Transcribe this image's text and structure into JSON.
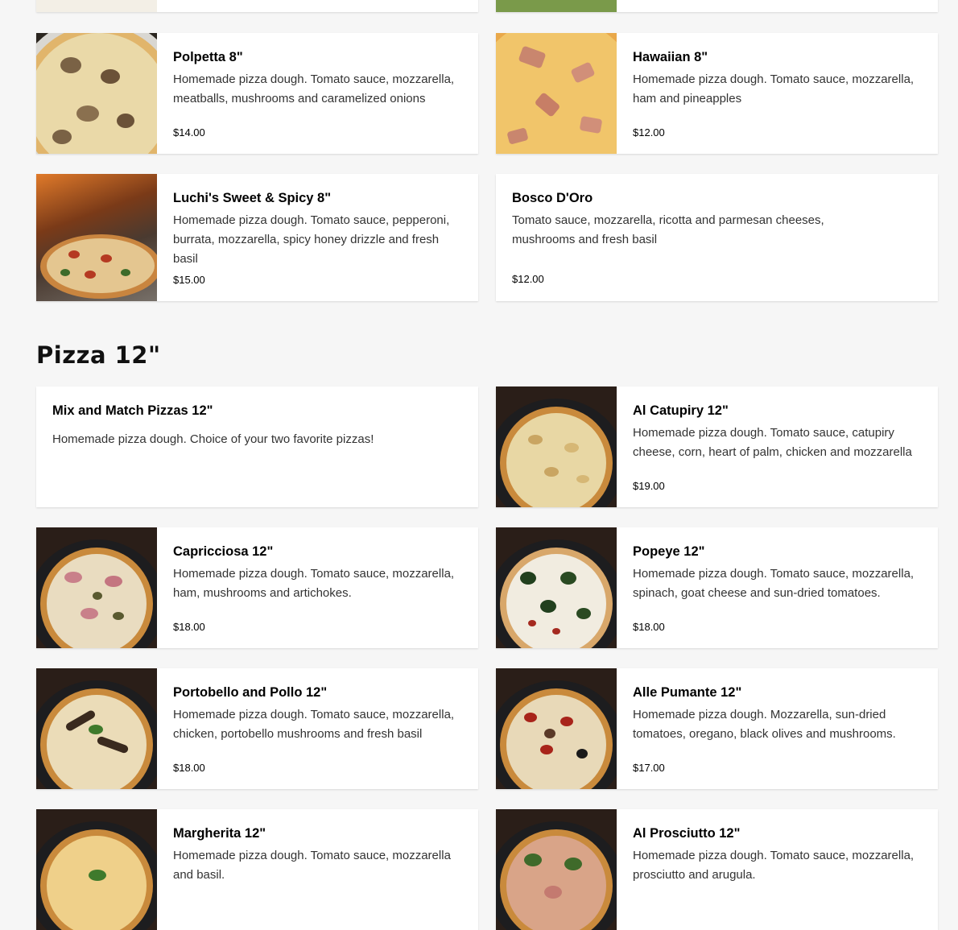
{
  "top_row": [
    {
      "name": "",
      "thumb": "cream"
    },
    {
      "name": "",
      "thumb": "salad"
    }
  ],
  "pizza8": [
    {
      "name": "Polpetta 8\"",
      "desc": "Homemade pizza dough. Tomato sauce, mozzarella, meatballs, mushrooms and caramelized onions",
      "price": "$14.00",
      "thumb": "mushroom"
    },
    {
      "name": "Hawaiian 8\"",
      "desc": "Homemade pizza dough. Tomato sauce, mozzarella, ham and pineapples",
      "price": "$12.00",
      "thumb": "ham"
    },
    {
      "name": "Luchi's Sweet & Spicy 8\"",
      "desc": "Homemade pizza dough. Tomato sauce, pepperoni, burrata, mozzarella, spicy honey drizzle and fresh basil",
      "price": "$15.00",
      "thumb": "oven"
    },
    {
      "name": "Bosco D'Oro",
      "desc": "Tomato sauce, mozzarella, ricotta and parmesan cheeses, mushrooms and fresh basil",
      "price": "$12.00",
      "thumb": ""
    }
  ],
  "section": {
    "title": "Pizza 12\""
  },
  "pizza12": [
    {
      "name": "Mix and Match Pizzas 12\"",
      "desc": "Homemade pizza dough. Choice of your two favorite pizzas!",
      "price": "",
      "thumb": ""
    },
    {
      "name": "Al Catupiry 12\"",
      "desc": "Homemade pizza dough. Tomato sauce, catupiry cheese, corn, heart of palm, chicken and mozzarella",
      "price": "$19.00",
      "thumb": "catupiry"
    },
    {
      "name": "Capricciosa 12\"",
      "desc": "Homemade pizza dough. Tomato sauce, mozzarella, ham, mushrooms and artichokes.",
      "price": "$18.00",
      "thumb": "capricciosa"
    },
    {
      "name": "Popeye 12\"",
      "desc": "Homemade pizza dough. Tomato sauce, mozzarella, spinach, goat cheese and sun-dried tomatoes.",
      "price": "$18.00",
      "thumb": "popeye"
    },
    {
      "name": "Portobello and Pollo 12\"",
      "desc": "Homemade pizza dough. Tomato sauce, mozzarella, chicken, portobello mushrooms and fresh basil",
      "price": "$18.00",
      "thumb": "portobello"
    },
    {
      "name": "Alle Pumante 12\"",
      "desc": "Homemade pizza dough. Mozzarella, sun-dried tomatoes, oregano, black olives and mushrooms.",
      "price": "$17.00",
      "thumb": "pumante"
    },
    {
      "name": "Margherita 12\"",
      "desc": "Homemade pizza dough. Tomato sauce, mozzarella and basil.",
      "price": "",
      "thumb": "margherita"
    },
    {
      "name": "Al Prosciutto 12\"",
      "desc": "Homemade pizza dough. Tomato sauce, mozzarella, prosciutto and arugula.",
      "price": "",
      "thumb": "prosciutto"
    }
  ]
}
